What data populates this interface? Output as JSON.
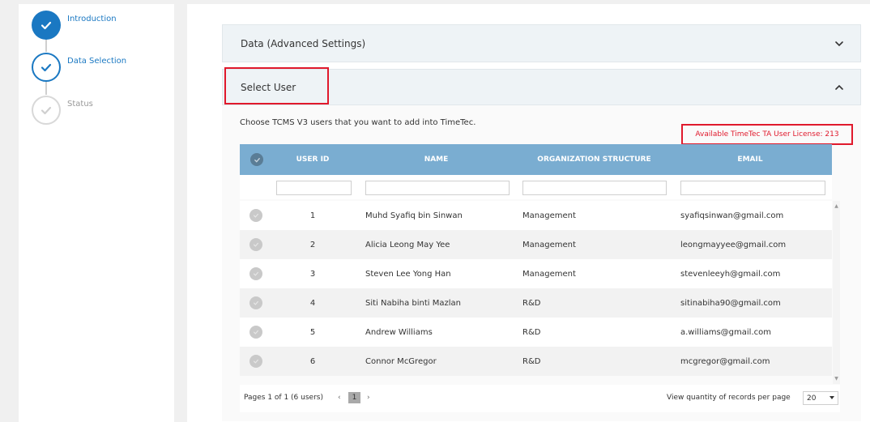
{
  "stepper": {
    "steps": [
      {
        "label": "Introduction",
        "state": "done"
      },
      {
        "label": "Data Selection",
        "state": "active"
      },
      {
        "label": "Status",
        "state": "pending"
      }
    ]
  },
  "sections": {
    "advanced": {
      "title": "Data (Advanced Settings)",
      "icon": "chevron-down-icon"
    },
    "select_user": {
      "title": "Select User",
      "icon": "chevron-up-icon"
    }
  },
  "select_user": {
    "instruction": "Choose TCMS V3 users that you want to add into TimeTec.",
    "license": "Available TimeTec TA User License: 213"
  },
  "table": {
    "columns": [
      "USER ID",
      "NAME",
      "ORGANIZATION STRUCTURE",
      "EMAIL"
    ],
    "filters": {
      "user_id": "",
      "name": "",
      "org": "",
      "email": ""
    },
    "rows": [
      {
        "id": "1",
        "name": "Muhd Syafiq bin Sinwan",
        "org": "Management",
        "email": "syafiqsinwan@gmail.com"
      },
      {
        "id": "2",
        "name": "Alicia Leong May Yee",
        "org": "Management",
        "email": "leongmayyee@gmail.com"
      },
      {
        "id": "3",
        "name": "Steven Lee Yong Han",
        "org": "Management",
        "email": "stevenleeyh@gmail.com"
      },
      {
        "id": "4",
        "name": "Siti Nabiha binti Mazlan",
        "org": "R&D",
        "email": "sitinabiha90@gmail.com"
      },
      {
        "id": "5",
        "name": "Andrew Williams",
        "org": "R&D",
        "email": "a.williams@gmail.com"
      },
      {
        "id": "6",
        "name": "Connor McGregor",
        "org": "R&D",
        "email": "mcgregor@gmail.com"
      }
    ]
  },
  "pager": {
    "summary": "Pages 1 of 1 (6 users)",
    "prev": "‹",
    "next": "›",
    "current_page": "1",
    "per_page_label": "View quantity of records per page",
    "per_page_value": "20"
  },
  "colors": {
    "accent": "#1a78c2",
    "table_header": "#7aadd1",
    "highlight": "#e0192c"
  }
}
